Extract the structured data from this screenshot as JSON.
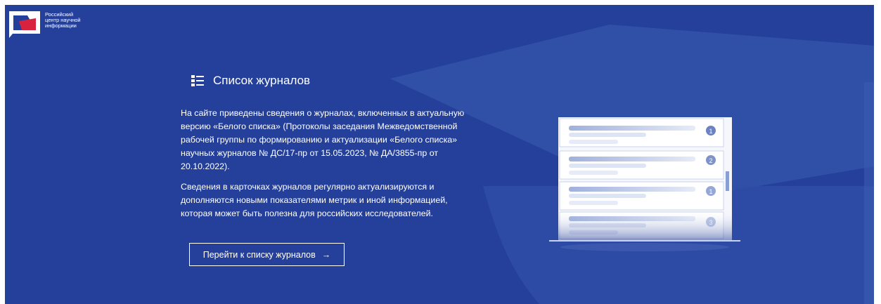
{
  "logo": {
    "line1": "Российский",
    "line2": "центр научной",
    "line3": "информации"
  },
  "section": {
    "title": "Список журналов",
    "paragraph1": "На сайте приведены сведения о журналах, включенных в актуальную версию «Белого списка» (Протоколы заседания Межведомственной рабочей группы по формированию и актуализации «Белого списка» научных журналов № ДС/17-пр от 15.05.2023, № ДА/3855-пр от 20.10.2022).",
    "paragraph2": "Сведения в карточках журналов регулярно актуализируются и дополняются новыми показателями метрик и иной информацией, которая может быть полезна для российских исследователей.",
    "button_label": "Перейти к списку журналов",
    "button_arrow": "→"
  },
  "illustration": {
    "card_numbers": [
      "1",
      "2",
      "1",
      "3"
    ]
  },
  "colors": {
    "background": "#25409a",
    "accent_light": "#8a9fd4"
  }
}
